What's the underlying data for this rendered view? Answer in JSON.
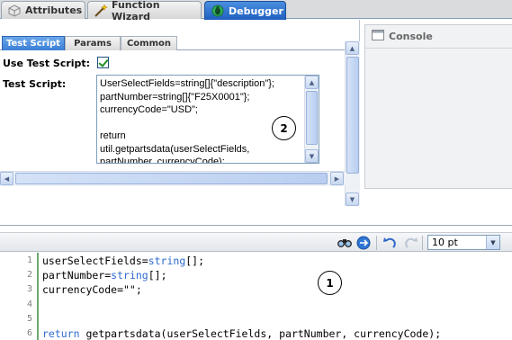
{
  "top_tabs": [
    {
      "label": "Attributes",
      "icon": "cube-icon",
      "active": false
    },
    {
      "label": "Function Wizard",
      "icon": "wand-icon",
      "active": false
    },
    {
      "label": "Debugger",
      "icon": "debugger-icon",
      "active": true
    }
  ],
  "sub_tabs": [
    {
      "label": "Test Script",
      "active": true
    },
    {
      "label": "Params",
      "active": false
    },
    {
      "label": "Common",
      "active": false
    }
  ],
  "form": {
    "use_test_script_label": "Use Test Script:",
    "use_test_script_checked": true,
    "test_script_label": "Test Script:",
    "test_script_value": "UserSelectFields=string[]{\"description\"};\npartNumber=string[]{\"F25X0001\"};\ncurrencyCode=\"USD\";\n\nreturn\nutil.getpartsdata(userSelectFields,\npartNumber, currencyCode);"
  },
  "callouts": {
    "script": "2",
    "editor": "1"
  },
  "console": {
    "title": "Console"
  },
  "toolbar": {
    "font_size_value": "10 pt"
  },
  "editor": {
    "lines": [
      {
        "num": "1",
        "parts": [
          {
            "t": "userSelectFields="
          },
          {
            "t": "string",
            "kw": true
          },
          {
            "t": "[];"
          }
        ]
      },
      {
        "num": "2",
        "parts": [
          {
            "t": "partNumber="
          },
          {
            "t": "string",
            "kw": true
          },
          {
            "t": "[];"
          }
        ]
      },
      {
        "num": "3",
        "parts": [
          {
            "t": "currencyCode=\"\";"
          }
        ]
      },
      {
        "num": "4",
        "parts": []
      },
      {
        "num": "5",
        "parts": []
      },
      {
        "num": "6",
        "parts": [
          {
            "t": "return",
            "kw": true
          },
          {
            "t": " getpartsdata(userSelectFields, partNumber, currencyCode);"
          }
        ]
      }
    ]
  },
  "colors": {
    "active_tab": "#1e5fbf",
    "keyword": "#2f6ad0",
    "gutter_border": "#6fa66f"
  }
}
